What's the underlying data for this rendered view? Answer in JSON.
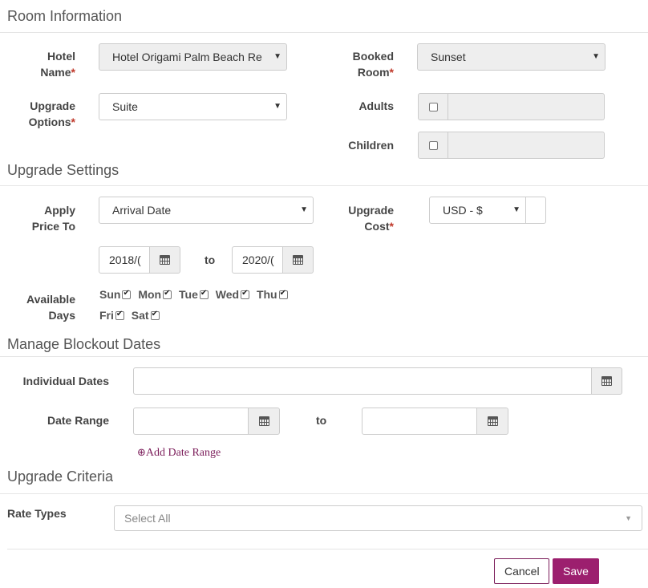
{
  "sections": {
    "room_information": "Room Information",
    "upgrade_settings": "Upgrade Settings",
    "manage_blockout": "Manage Blockout Dates",
    "upgrade_criteria": "Upgrade Criteria"
  },
  "room": {
    "hotel_name_label_1": "Hotel",
    "hotel_name_label_2": "Name",
    "hotel_name_value": "Hotel Origami Palm Beach Re",
    "booked_room_label_1": "Booked",
    "booked_room_label_2": "Room",
    "booked_room_value": "Sunset",
    "upgrade_options_label_1": "Upgrade",
    "upgrade_options_label_2": "Options",
    "upgrade_options_value": "Suite",
    "adults_label": "Adults",
    "children_label": "Children",
    "required_mark": "*"
  },
  "settings": {
    "apply_price_label_1": "Apply",
    "apply_price_label_2": "Price To",
    "apply_price_value": "Arrival Date",
    "upgrade_cost_label_1": "Upgrade",
    "upgrade_cost_label_2": "Cost",
    "currency_value": "USD - $",
    "date_from": "2018/(",
    "date_to": "2020/(",
    "to_label": "to",
    "available_days_label_1": "Available",
    "available_days_label_2": "Days",
    "days": [
      {
        "name": "Sun",
        "checked": true
      },
      {
        "name": "Mon",
        "checked": true
      },
      {
        "name": "Tue",
        "checked": true
      },
      {
        "name": "Wed",
        "checked": true
      },
      {
        "name": "Thu",
        "checked": true
      },
      {
        "name": "Fri",
        "checked": true
      },
      {
        "name": "Sat",
        "checked": true
      }
    ]
  },
  "blockout": {
    "individual_dates_label": "Individual Dates",
    "date_range_label": "Date Range",
    "to_label": "to",
    "add_date_range": "Add Date Range"
  },
  "criteria": {
    "rate_types_label": "Rate Types",
    "rate_types_placeholder": "Select All"
  },
  "footer": {
    "cancel_label": "Cancel",
    "save_label": "Save"
  },
  "colors": {
    "accent": "#9c1f6e",
    "required": "#c0392b"
  },
  "icons": {
    "calendar": "calendar-icon",
    "caret": "caret-down-icon",
    "add": "plus-circle-icon"
  }
}
